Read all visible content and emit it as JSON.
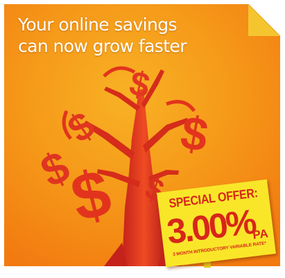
{
  "headline": {
    "line1": "Your online savings",
    "line2": "can now grow faster"
  },
  "offer": {
    "label": "SPECIAL OFFER:",
    "rate": "3.00%",
    "pa": "PA",
    "note": "3 MONTH INTRODUCTORY VARIABLE RATE*"
  },
  "illustration": {
    "subject": "money-tree-icon",
    "leaf_symbol": "$"
  },
  "colors": {
    "background_top": "#f7a21b",
    "background_bottom": "#f57a0f",
    "tree": "#e2341d",
    "sign": "#f9e629",
    "sign_text": "#d8261a",
    "corner_fold": "#f8d23b"
  }
}
